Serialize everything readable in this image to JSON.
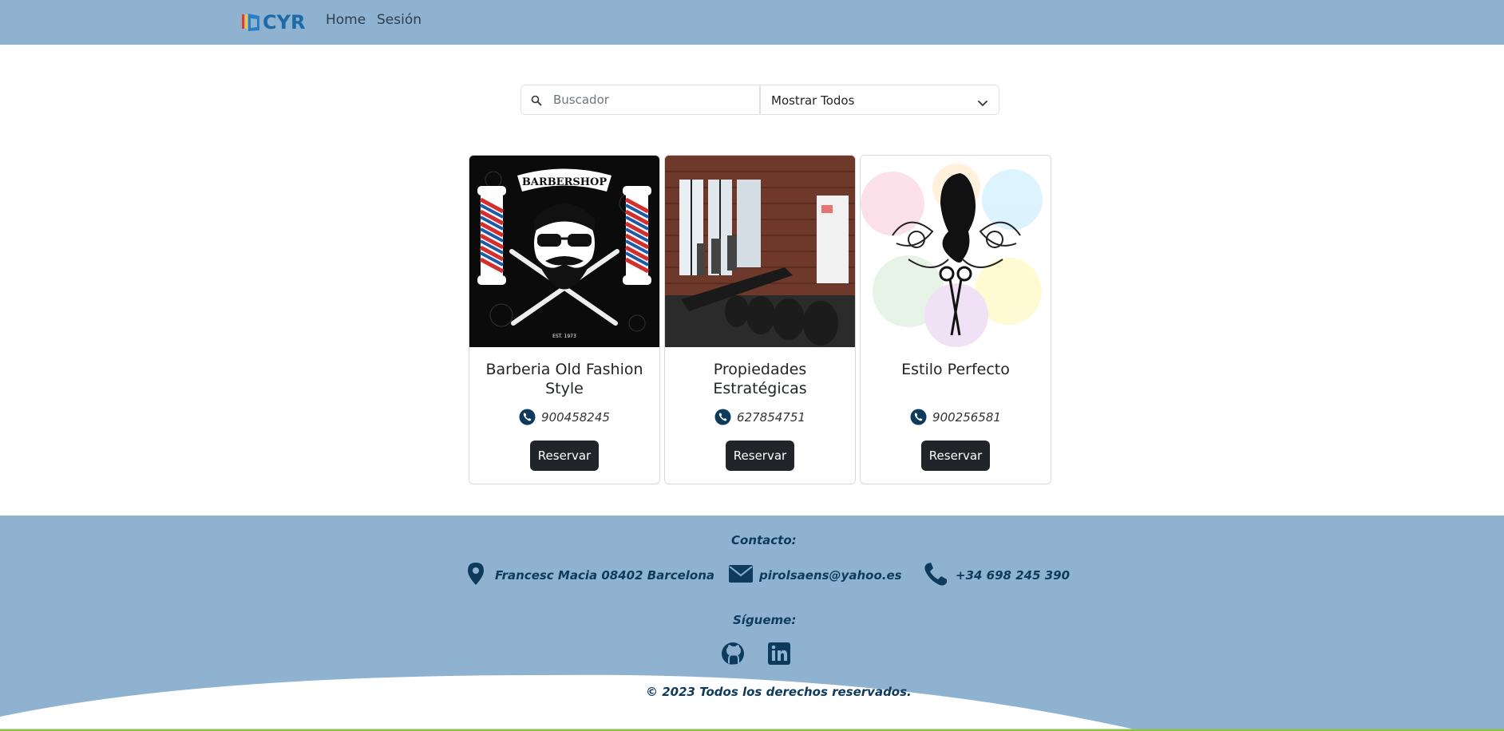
{
  "navbar": {
    "brand": "CYR",
    "links": [
      "Home",
      "Sesión"
    ]
  },
  "search": {
    "placeholder": "Buscador",
    "value": "",
    "filter_selected": "Mostrar Todos"
  },
  "cards": [
    {
      "title": "Barberia Old Fashion Style",
      "phone": "900458245",
      "button": "Reservar",
      "image": "barbershop-logo",
      "image_text": [
        "BARBERSHOP",
        "EST. 1973"
      ]
    },
    {
      "title": "Propiedades Estratégicas",
      "phone": "627854751",
      "button": "Reservar",
      "image": "office-photo",
      "image_text": []
    },
    {
      "title": "Estilo Perfecto",
      "phone": "900256581",
      "button": "Reservar",
      "image": "salon-logo",
      "image_text": []
    }
  ],
  "footer": {
    "contact_heading": "Contacto:",
    "address": "Francesc Macia 08402 Barcelona",
    "email": "pirolsaens@yahoo.es",
    "phone": "+34 698 245 390",
    "follow_heading": "Sígueme:",
    "social": [
      "github-icon",
      "linkedin-icon"
    ],
    "copyright": "© 2023 Todos los derechos reservados."
  },
  "colors": {
    "navbar_bg": "#8fb2d0",
    "footer_bg": "#8fb2d0",
    "footer_text": "#0e3a5c",
    "button_bg": "#212529",
    "wave_line": "#8bc34a"
  }
}
